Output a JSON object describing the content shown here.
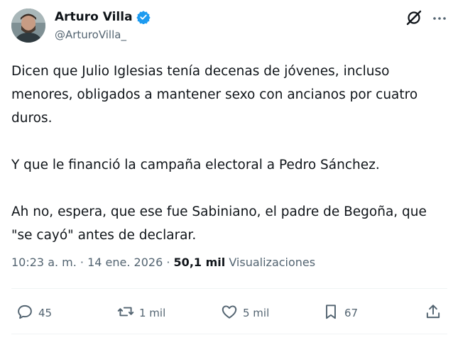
{
  "author": {
    "display_name": "Arturo Villa",
    "handle": "@ArturoVilla_",
    "verified_color": "#1d9bf0"
  },
  "header_icons": [
    "grok-icon",
    "more-icon"
  ],
  "tweet": {
    "paragraphs": [
      "Dicen que Julio Iglesias tenía decenas de jóvenes, incluso menores, obligados a mantener sexo con ancianos por cuatro duros.",
      "Y que le financió la campaña electoral a Pedro Sánchez.",
      "Ah no, espera, que ese fue Sabiniano, el padre de Begoña, que \"se cayó\" antes de declarar."
    ]
  },
  "meta": {
    "time": "10:23 a. m.",
    "sep1": " · ",
    "date": "14 ene. 2026",
    "sep2": " · ",
    "views_count": "50,1 mil",
    "views_label": "Visualizaciones"
  },
  "actions": {
    "replies": "45",
    "reposts": "1 mil",
    "likes": "5 mil",
    "bookmarks": "67"
  }
}
